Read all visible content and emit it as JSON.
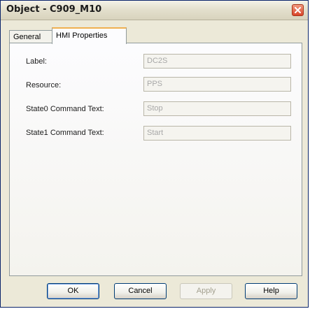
{
  "window": {
    "title": "Object - C909_M10"
  },
  "tabs": [
    {
      "label": "General"
    },
    {
      "label": "HMI Properties"
    }
  ],
  "fields": [
    {
      "label": "Label:",
      "value": "DC2S"
    },
    {
      "label": "Resource:",
      "value": "PPS"
    },
    {
      "label": "State0 Command Text:",
      "value": "Stop"
    },
    {
      "label": "State1 Command Text:",
      "value": "Start"
    }
  ],
  "buttons": {
    "ok": "OK",
    "cancel": "Cancel",
    "apply": "Apply",
    "help": "Help"
  },
  "icons": {
    "close": "close-icon"
  },
  "colors": {
    "close_button": "#d9452a",
    "active_tab_accent": "#f0b050"
  }
}
